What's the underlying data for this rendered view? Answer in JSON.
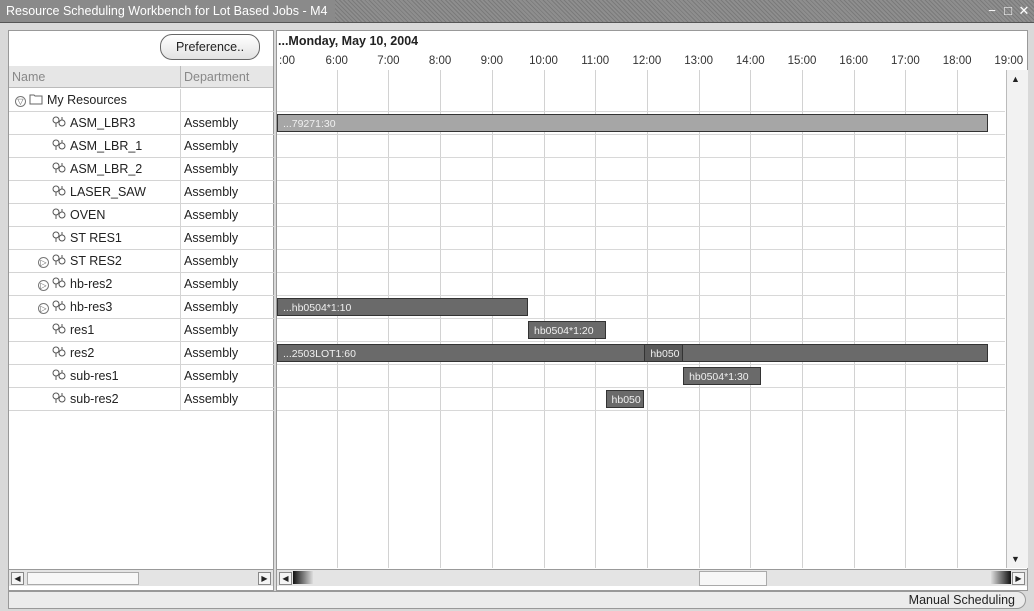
{
  "window": {
    "title": "Resource Scheduling Workbench for Lot Based Jobs - M4",
    "controls": [
      "minimize-icon",
      "maximize-icon",
      "close-icon"
    ]
  },
  "left_pane": {
    "preference_button": "Preference..",
    "columns": {
      "name": "Name",
      "department": "Department"
    },
    "tree_root": "My Resources",
    "resources": [
      {
        "name": "ASM_LBR3",
        "department": "Assembly",
        "expandable": false
      },
      {
        "name": "ASM_LBR_1",
        "department": "Assembly",
        "expandable": false
      },
      {
        "name": "ASM_LBR_2",
        "department": "Assembly",
        "expandable": false
      },
      {
        "name": "LASER_SAW",
        "department": "Assembly",
        "expandable": false
      },
      {
        "name": "OVEN",
        "department": "Assembly",
        "expandable": false
      },
      {
        "name": "ST RES1",
        "department": "Assembly",
        "expandable": false
      },
      {
        "name": "ST RES2",
        "department": "Assembly",
        "expandable": true
      },
      {
        "name": "hb-res2",
        "department": "Assembly",
        "expandable": true
      },
      {
        "name": "hb-res3",
        "department": "Assembly",
        "expandable": true
      },
      {
        "name": "res1",
        "department": "Assembly",
        "expandable": false
      },
      {
        "name": "res2",
        "department": "Assembly",
        "expandable": false
      },
      {
        "name": "sub-res1",
        "department": "Assembly",
        "expandable": false
      },
      {
        "name": "sub-res2",
        "department": "Assembly",
        "expandable": false
      }
    ]
  },
  "gantt": {
    "date_header": "...Monday, May 10, 2004",
    "hours": [
      ":00",
      "6:00",
      "7:00",
      "8:00",
      "9:00",
      "10:00",
      "11:00",
      "12:00",
      "13:00",
      "14:00",
      "15:00",
      "16:00",
      "17:00",
      "18:00",
      "19:00"
    ],
    "bars": [
      {
        "resource": "ASM_LBR3",
        "label": "...79271:30",
        "start": 4.5,
        "end": 18.6,
        "color": "#a6a6a6"
      },
      {
        "resource": "hb-res3",
        "label": "...hb0504*1:10",
        "start": 4.5,
        "end": 9.7,
        "color": "#6a6a6a"
      },
      {
        "resource": "res1",
        "label": "hb0504*1:20",
        "start": 9.7,
        "end": 11.2,
        "color": "#6a6a6a"
      },
      {
        "resource": "res2",
        "label": "...2503LOT1:60",
        "start": 4.5,
        "end": 18.6,
        "color": "#6a6a6a"
      },
      {
        "resource": "res2",
        "label": "hb050",
        "start": 11.95,
        "end": 12.7,
        "color": "#5a5a5a"
      },
      {
        "resource": "sub-res1",
        "label": "hb0504*1:30",
        "start": 12.7,
        "end": 14.2,
        "color": "#6a6a6a"
      },
      {
        "resource": "sub-res2",
        "label": "hb050",
        "start": 11.2,
        "end": 11.95,
        "color": "#6a6a6a"
      }
    ]
  },
  "status_bar": {
    "mode": "Manual Scheduling"
  }
}
